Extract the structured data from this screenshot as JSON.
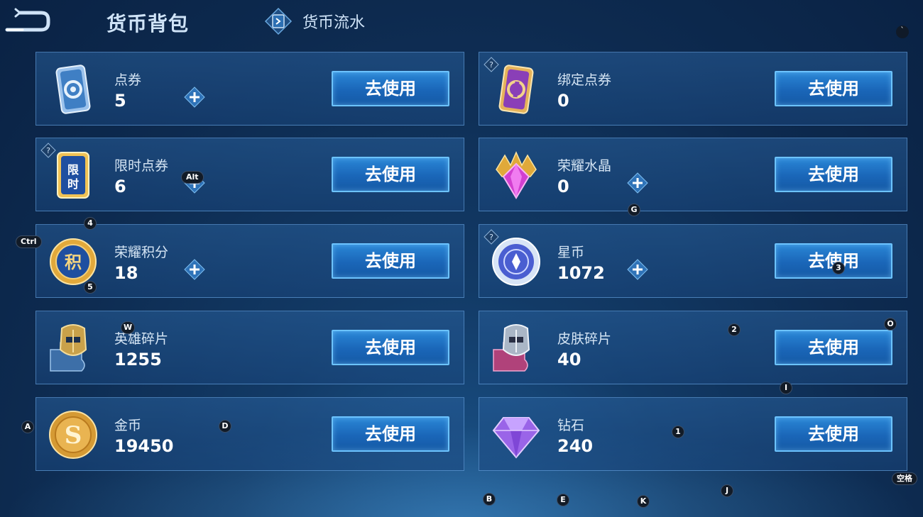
{
  "header": {
    "title": "货币背包",
    "flow_label": "货币流水"
  },
  "colors": {
    "accent": "#2a86d6",
    "button_border": "#6cc3ff",
    "background": "#0d2a4f"
  },
  "cards": [
    {
      "name": "点券",
      "value": "5",
      "button": "去使用",
      "has_plus": true,
      "has_help": false,
      "icon": "blue-ticket-icon"
    },
    {
      "name": "绑定点券",
      "value": "0",
      "button": "去使用",
      "has_plus": false,
      "has_help": true,
      "icon": "purple-ticket-icon"
    },
    {
      "name": "限时点券",
      "value": "6",
      "button": "去使用",
      "has_plus": true,
      "has_help": true,
      "icon": "limited-ticket-icon",
      "icon_text": "限时"
    },
    {
      "name": "荣耀水晶",
      "value": "0",
      "button": "去使用",
      "has_plus": true,
      "has_help": false,
      "icon": "glory-crystal-icon"
    },
    {
      "name": "荣耀积分",
      "value": "18",
      "button": "去使用",
      "has_plus": true,
      "has_help": false,
      "icon": "glory-points-icon",
      "icon_text": "积"
    },
    {
      "name": "星币",
      "value": "1072",
      "button": "去使用",
      "has_plus": true,
      "has_help": true,
      "icon": "star-coin-icon"
    },
    {
      "name": "英雄碎片",
      "value": "1255",
      "button": "去使用",
      "has_plus": false,
      "has_help": false,
      "icon": "hero-fragment-icon"
    },
    {
      "name": "皮肤碎片",
      "value": "40",
      "button": "去使用",
      "has_plus": false,
      "has_help": false,
      "icon": "skin-fragment-icon"
    },
    {
      "name": "金币",
      "value": "19450",
      "button": "去使用",
      "has_plus": false,
      "has_help": false,
      "icon": "gold-coin-icon",
      "icon_text": "S"
    },
    {
      "name": "钻石",
      "value": "240",
      "button": "去使用",
      "has_plus": false,
      "has_help": false,
      "icon": "diamond-icon"
    }
  ],
  "key_hints": {
    "tick": "`",
    "alt": "Alt",
    "g": "G",
    "four": "4",
    "ctrl": "Ctrl",
    "five": "5",
    "three": "3",
    "w": "W",
    "two": "2",
    "o": "O",
    "i": "I",
    "a": "A",
    "d": "D",
    "one": "1",
    "space": "空格",
    "b": "B",
    "e": "E",
    "k": "K",
    "j": "J"
  }
}
